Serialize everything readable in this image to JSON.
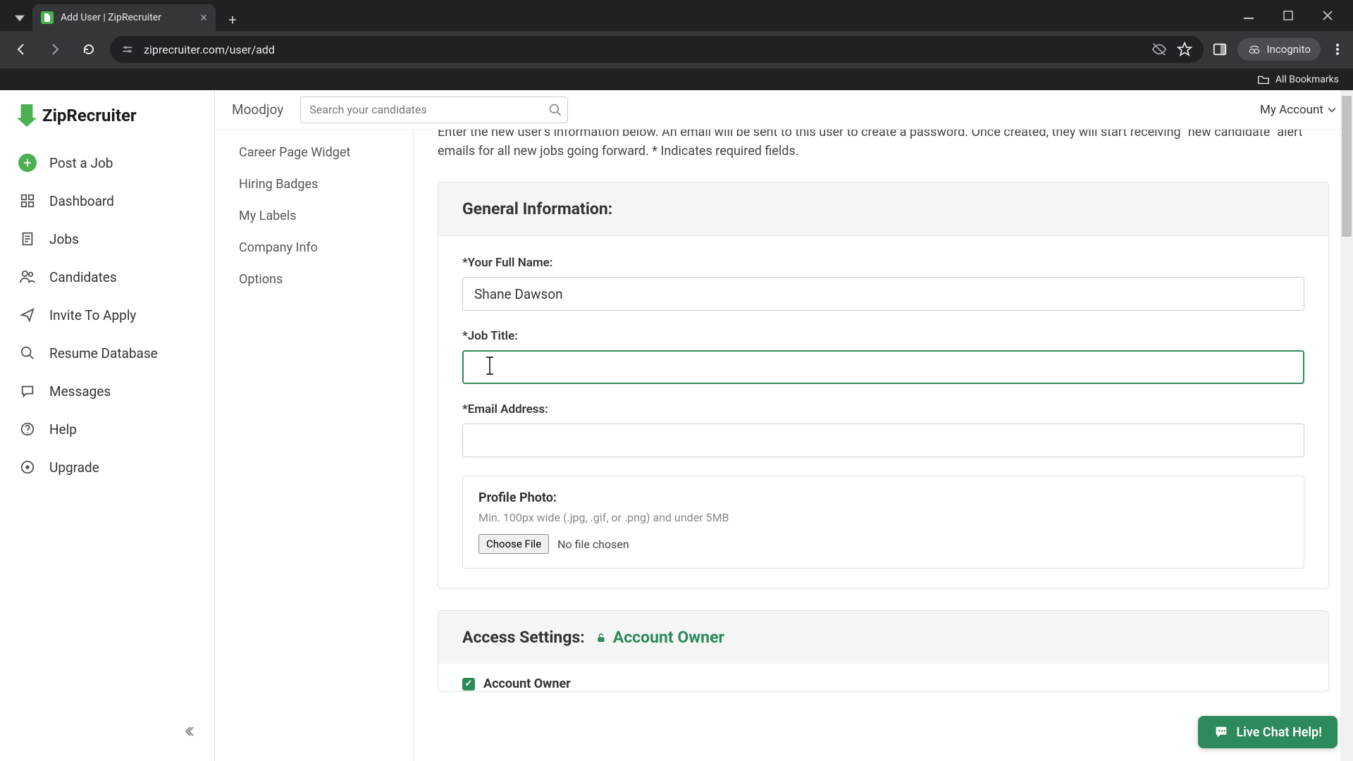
{
  "browser": {
    "tab_title": "Add User | ZipRecruiter",
    "url": "ziprecruiter.com/user/add",
    "incognito_label": "Incognito",
    "all_bookmarks": "All Bookmarks"
  },
  "logo": {
    "text": "ZipRecruiter"
  },
  "sidebar": {
    "items": [
      {
        "label": "Post a Job"
      },
      {
        "label": "Dashboard"
      },
      {
        "label": "Jobs"
      },
      {
        "label": "Candidates"
      },
      {
        "label": "Invite To Apply"
      },
      {
        "label": "Resume Database"
      },
      {
        "label": "Messages"
      },
      {
        "label": "Help"
      },
      {
        "label": "Upgrade"
      }
    ]
  },
  "submenu": {
    "items": [
      {
        "label": "Career Page Widget"
      },
      {
        "label": "Hiring Badges"
      },
      {
        "label": "My Labels"
      },
      {
        "label": "Company Info"
      },
      {
        "label": "Options"
      }
    ]
  },
  "topbar": {
    "workspace": "Moodjoy",
    "search_placeholder": "Search your candidates",
    "my_account": "My Account"
  },
  "intro": "Enter the new user's information below. An email will be sent to this user to create a password. Once created, they will start receiving \"new candidate\" alert emails for all new jobs going forward. * Indicates required fields.",
  "form": {
    "section_general": "General Information:",
    "full_name_label": "*Your Full Name:",
    "full_name_value": "Shane Dawson",
    "job_title_label": "*Job Title:",
    "job_title_value": "",
    "email_label": "*Email Address:",
    "email_value": "",
    "photo_title": "Profile Photo:",
    "photo_hint": "Min. 100px wide (.jpg, .gif, or .png) and under 5MB",
    "choose_file": "Choose File",
    "no_file": "No file chosen",
    "section_access": "Access Settings:",
    "owner_badge": "Account Owner",
    "owner_checkbox": "Account Owner"
  },
  "chat": {
    "label": "Live Chat Help!"
  }
}
